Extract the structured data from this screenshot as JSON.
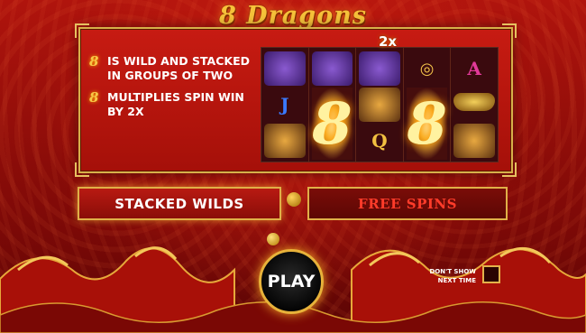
{
  "game": {
    "title": "8 Dragons"
  },
  "info": {
    "line1_symbol": "8",
    "line1_text": "IS WILD AND STACKED IN GROUPS OF TWO",
    "line2_symbol": "8",
    "line2_text": "MULTIPLIES SPIN WIN BY 2X"
  },
  "reels": {
    "multiplier": "2x",
    "letter_a": "A",
    "letter_j": "J",
    "letter_q": "Q",
    "wild": "8"
  },
  "tabs": {
    "stacked_wilds": "STACKED WILDS",
    "free_spins": "FREE SPINS"
  },
  "play": {
    "label": "PLAY"
  },
  "dont_show": {
    "label": "DON'T SHOW NEXT TIME"
  },
  "colors": {
    "gold": "#e0b048",
    "red": "#b81a12",
    "free_spins_text": "#ff3c2a"
  }
}
